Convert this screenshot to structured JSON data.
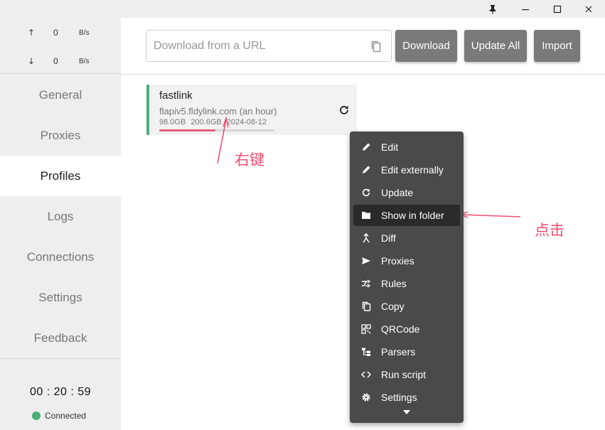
{
  "titlebar": {
    "pin_icon": "pin-icon",
    "minimize_icon": "minimize-icon",
    "maximize_icon": "maximize-icon",
    "close_icon": "close-icon"
  },
  "traffic": {
    "upload": {
      "arrow": "↑",
      "value": "0",
      "unit": "B/s"
    },
    "download": {
      "arrow": "↓",
      "value": "0",
      "unit": "B/s"
    }
  },
  "nav": [
    {
      "label": "General"
    },
    {
      "label": "Proxies"
    },
    {
      "label": "Profiles"
    },
    {
      "label": "Logs"
    },
    {
      "label": "Connections"
    },
    {
      "label": "Settings"
    },
    {
      "label": "Feedback"
    }
  ],
  "active_nav": "Profiles",
  "status": {
    "clock": "00 : 20 : 59",
    "connection": "Connected",
    "connection_color": "#4caf79"
  },
  "toolbar": {
    "url_placeholder": "Download from a URL",
    "url_value": "",
    "download_label": "Download",
    "update_all_label": "Update All",
    "import_label": "Import"
  },
  "profile": {
    "name": "fastlink",
    "host": "flapiv5.fldylink.com (an hour)",
    "used": "98.0GB",
    "total": "200.6GB",
    "expire": "2024-08-12",
    "usage_fraction": 0.49,
    "accent_color": "#4caf79"
  },
  "annotations": {
    "right_click": "右键",
    "click": "点击",
    "color": "#ef4f6f"
  },
  "context_menu": {
    "items": [
      {
        "label": "Edit",
        "icon": "pencil-icon"
      },
      {
        "label": "Edit externally",
        "icon": "pencil-icon"
      },
      {
        "label": "Update",
        "icon": "refresh-icon"
      },
      {
        "label": "Show in folder",
        "icon": "folder-icon"
      },
      {
        "label": "Diff",
        "icon": "merge-icon"
      },
      {
        "label": "Proxies",
        "icon": "send-icon"
      },
      {
        "label": "Rules",
        "icon": "shuffle-icon"
      },
      {
        "label": "Copy",
        "icon": "copy-icon"
      },
      {
        "label": "QRCode",
        "icon": "qrcode-icon"
      },
      {
        "label": "Parsers",
        "icon": "tree-icon"
      },
      {
        "label": "Run script",
        "icon": "code-icon"
      },
      {
        "label": "Settings",
        "icon": "gear-icon"
      }
    ],
    "highlighted": "Show in folder",
    "more_icon": "chevron-down-icon"
  }
}
